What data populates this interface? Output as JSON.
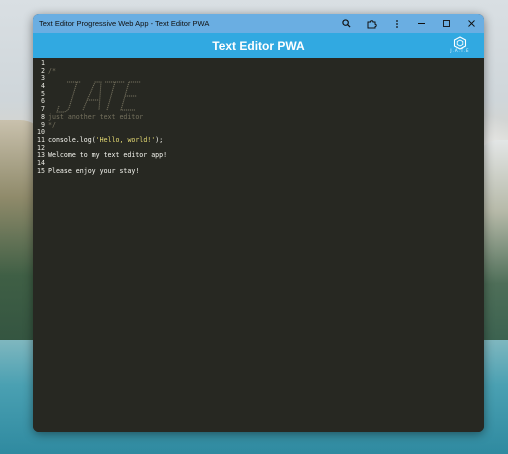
{
  "window": {
    "title": "Text Editor Progressive Web App - Text Editor PWA",
    "controls": [
      "search-icon",
      "extension-icon",
      "more-icon",
      "minimize-icon",
      "maximize-icon",
      "close-icon"
    ]
  },
  "app": {
    "title": "Text Editor PWA",
    "logo_caption": "J.A.T.E"
  },
  "editor": {
    "line_numbers": [
      "1",
      "2",
      "3",
      "4",
      "5",
      "6",
      "7",
      "8",
      "9",
      "10",
      "11",
      "12",
      "13",
      "14",
      "15"
    ],
    "ascii_logo_text": "JATE",
    "lines": {
      "l2": "/*",
      "l8": "just another text editor",
      "l9": "*/",
      "l11_a": "console",
      "l11_b": ".",
      "l11_c": "log",
      "l11_d": "(",
      "l11_e": "'Hello, world!'",
      "l11_f": ");",
      "l13": "Welcome to my text editor app!",
      "l15": "Please enjoy your stay!"
    }
  },
  "colors": {
    "titlebar": "#6aaee2",
    "appbar": "#31a9e1",
    "editor_bg": "#272822",
    "comment": "#75715e",
    "string": "#e6db74"
  }
}
